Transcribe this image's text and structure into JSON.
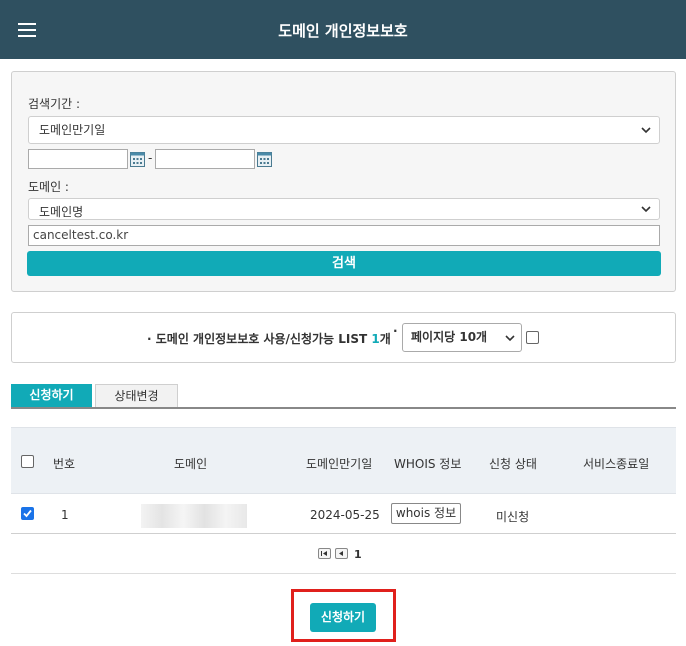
{
  "header": {
    "title": "도메인 개인정보보호"
  },
  "search": {
    "period_label": "검색기간 :",
    "period_select": "도메인만기일",
    "date_from": "",
    "date_to": "",
    "date_separator": "-",
    "domain_label": "도메인 :",
    "domain_select": "도메인명",
    "domain_value": "canceltest.co.kr",
    "search_button": "검색"
  },
  "list_info": {
    "bullet": "·",
    "caption_prefix": "· 도메인 개인정보보호 사용/신청가능 LIST ",
    "count": "1",
    "caption_suffix": "개",
    "per_page": "페이지당 10개"
  },
  "tabs": [
    {
      "label": "신청하기",
      "active": true
    },
    {
      "label": "상태변경",
      "active": false
    }
  ],
  "table": {
    "columns": [
      "번호",
      "도메인",
      "도메인만기일",
      "WHOIS 정보",
      "신청 상태",
      "서비스종료일"
    ],
    "rows": [
      {
        "checked": true,
        "no": "1",
        "domain": "",
        "expiry": "2024-05-25",
        "whois": "whois 정보",
        "status": "미신청",
        "end_date": ""
      }
    ]
  },
  "pagination": {
    "current": "1"
  },
  "actions": {
    "apply_button": "신청하기"
  },
  "colors": {
    "header_bg": "#2f5060",
    "accent": "#11aab7",
    "highlight": "#e0201c"
  }
}
